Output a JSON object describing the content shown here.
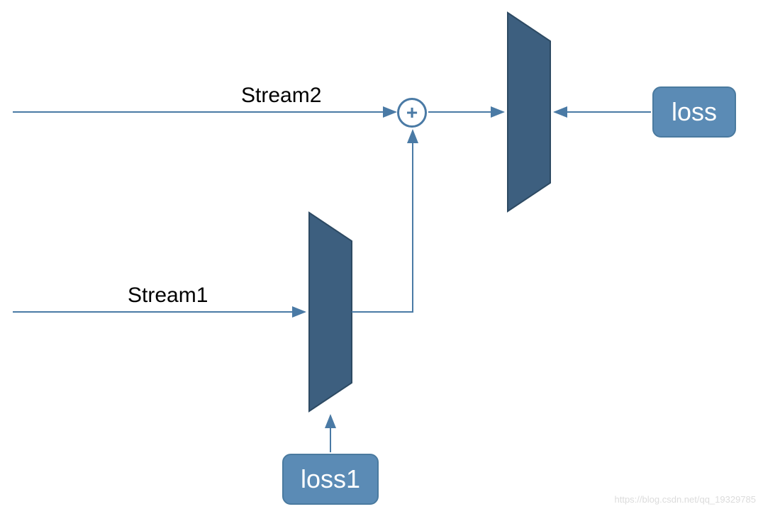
{
  "labels": {
    "stream1": "Stream1",
    "stream2": "Stream2",
    "loss": "loss",
    "loss1": "loss1",
    "plus": "+"
  },
  "colors": {
    "stroke": "#4a7aa5",
    "shape_fill": "#3d5f7f",
    "box_fill": "#5b8bb5",
    "box_stroke": "#4a7a9f"
  },
  "watermark": "https://blog.csdn.net/qq_19329785"
}
